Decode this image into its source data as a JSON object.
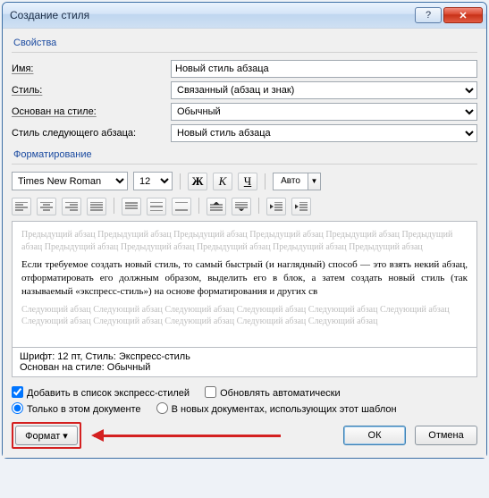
{
  "title": "Создание стиля",
  "properties": {
    "group_label": "Свойства",
    "name_label": "Имя:",
    "name_value": "Новый стиль абзаца",
    "style_type_label": "Стиль:",
    "style_type_value": "Связанный (абзац и знак)",
    "based_on_label": "Основан на стиле:",
    "based_on_value": "Обычный",
    "next_style_label": "Стиль следующего абзаца:",
    "next_style_value": "Новый стиль абзаца"
  },
  "formatting": {
    "group_label": "Форматирование",
    "font_name": "Times New Roman",
    "font_size": "12",
    "bold": "Ж",
    "italic": "К",
    "underline": "Ч",
    "color_select": "Авто"
  },
  "preview": {
    "ghost_prev": "Предыдущий абзац Предыдущий абзац Предыдущий абзац Предыдущий абзац Предыдущий абзац Предыдущий абзац Предыдущий абзац Предыдущий абзац Предыдущий абзац Предыдущий абзац Предыдущий абзац",
    "sample": "Если требуемое создать новый стиль, то самый быстрый (и наглядный) способ — это взять некий абзац, отформатировать его должным образом, выделить его в блок, а затем создать новый стиль (так называемый «экспресс-стиль») на основе форматирования и других св",
    "ghost_next": "Следующий абзац Следующий абзац Следующий абзац Следующий абзац Следующий абзац Следующий абзац Следующий абзац Следующий абзац Следующий абзац Следующий абзац Следующий абзац"
  },
  "description": {
    "line1": "Шрифт: 12 пт, Стиль: Экспресс-стиль",
    "line2": "Основан на стиле: Обычный"
  },
  "options": {
    "add_quick": "Добавить в список экспресс-стилей",
    "auto_update": "Обновлять автоматически",
    "only_doc": "Только в этом документе",
    "in_template": "В новых документах, использующих этот шаблон"
  },
  "buttons": {
    "format": "Формат ▾",
    "ok": "ОК",
    "cancel": "Отмена"
  }
}
